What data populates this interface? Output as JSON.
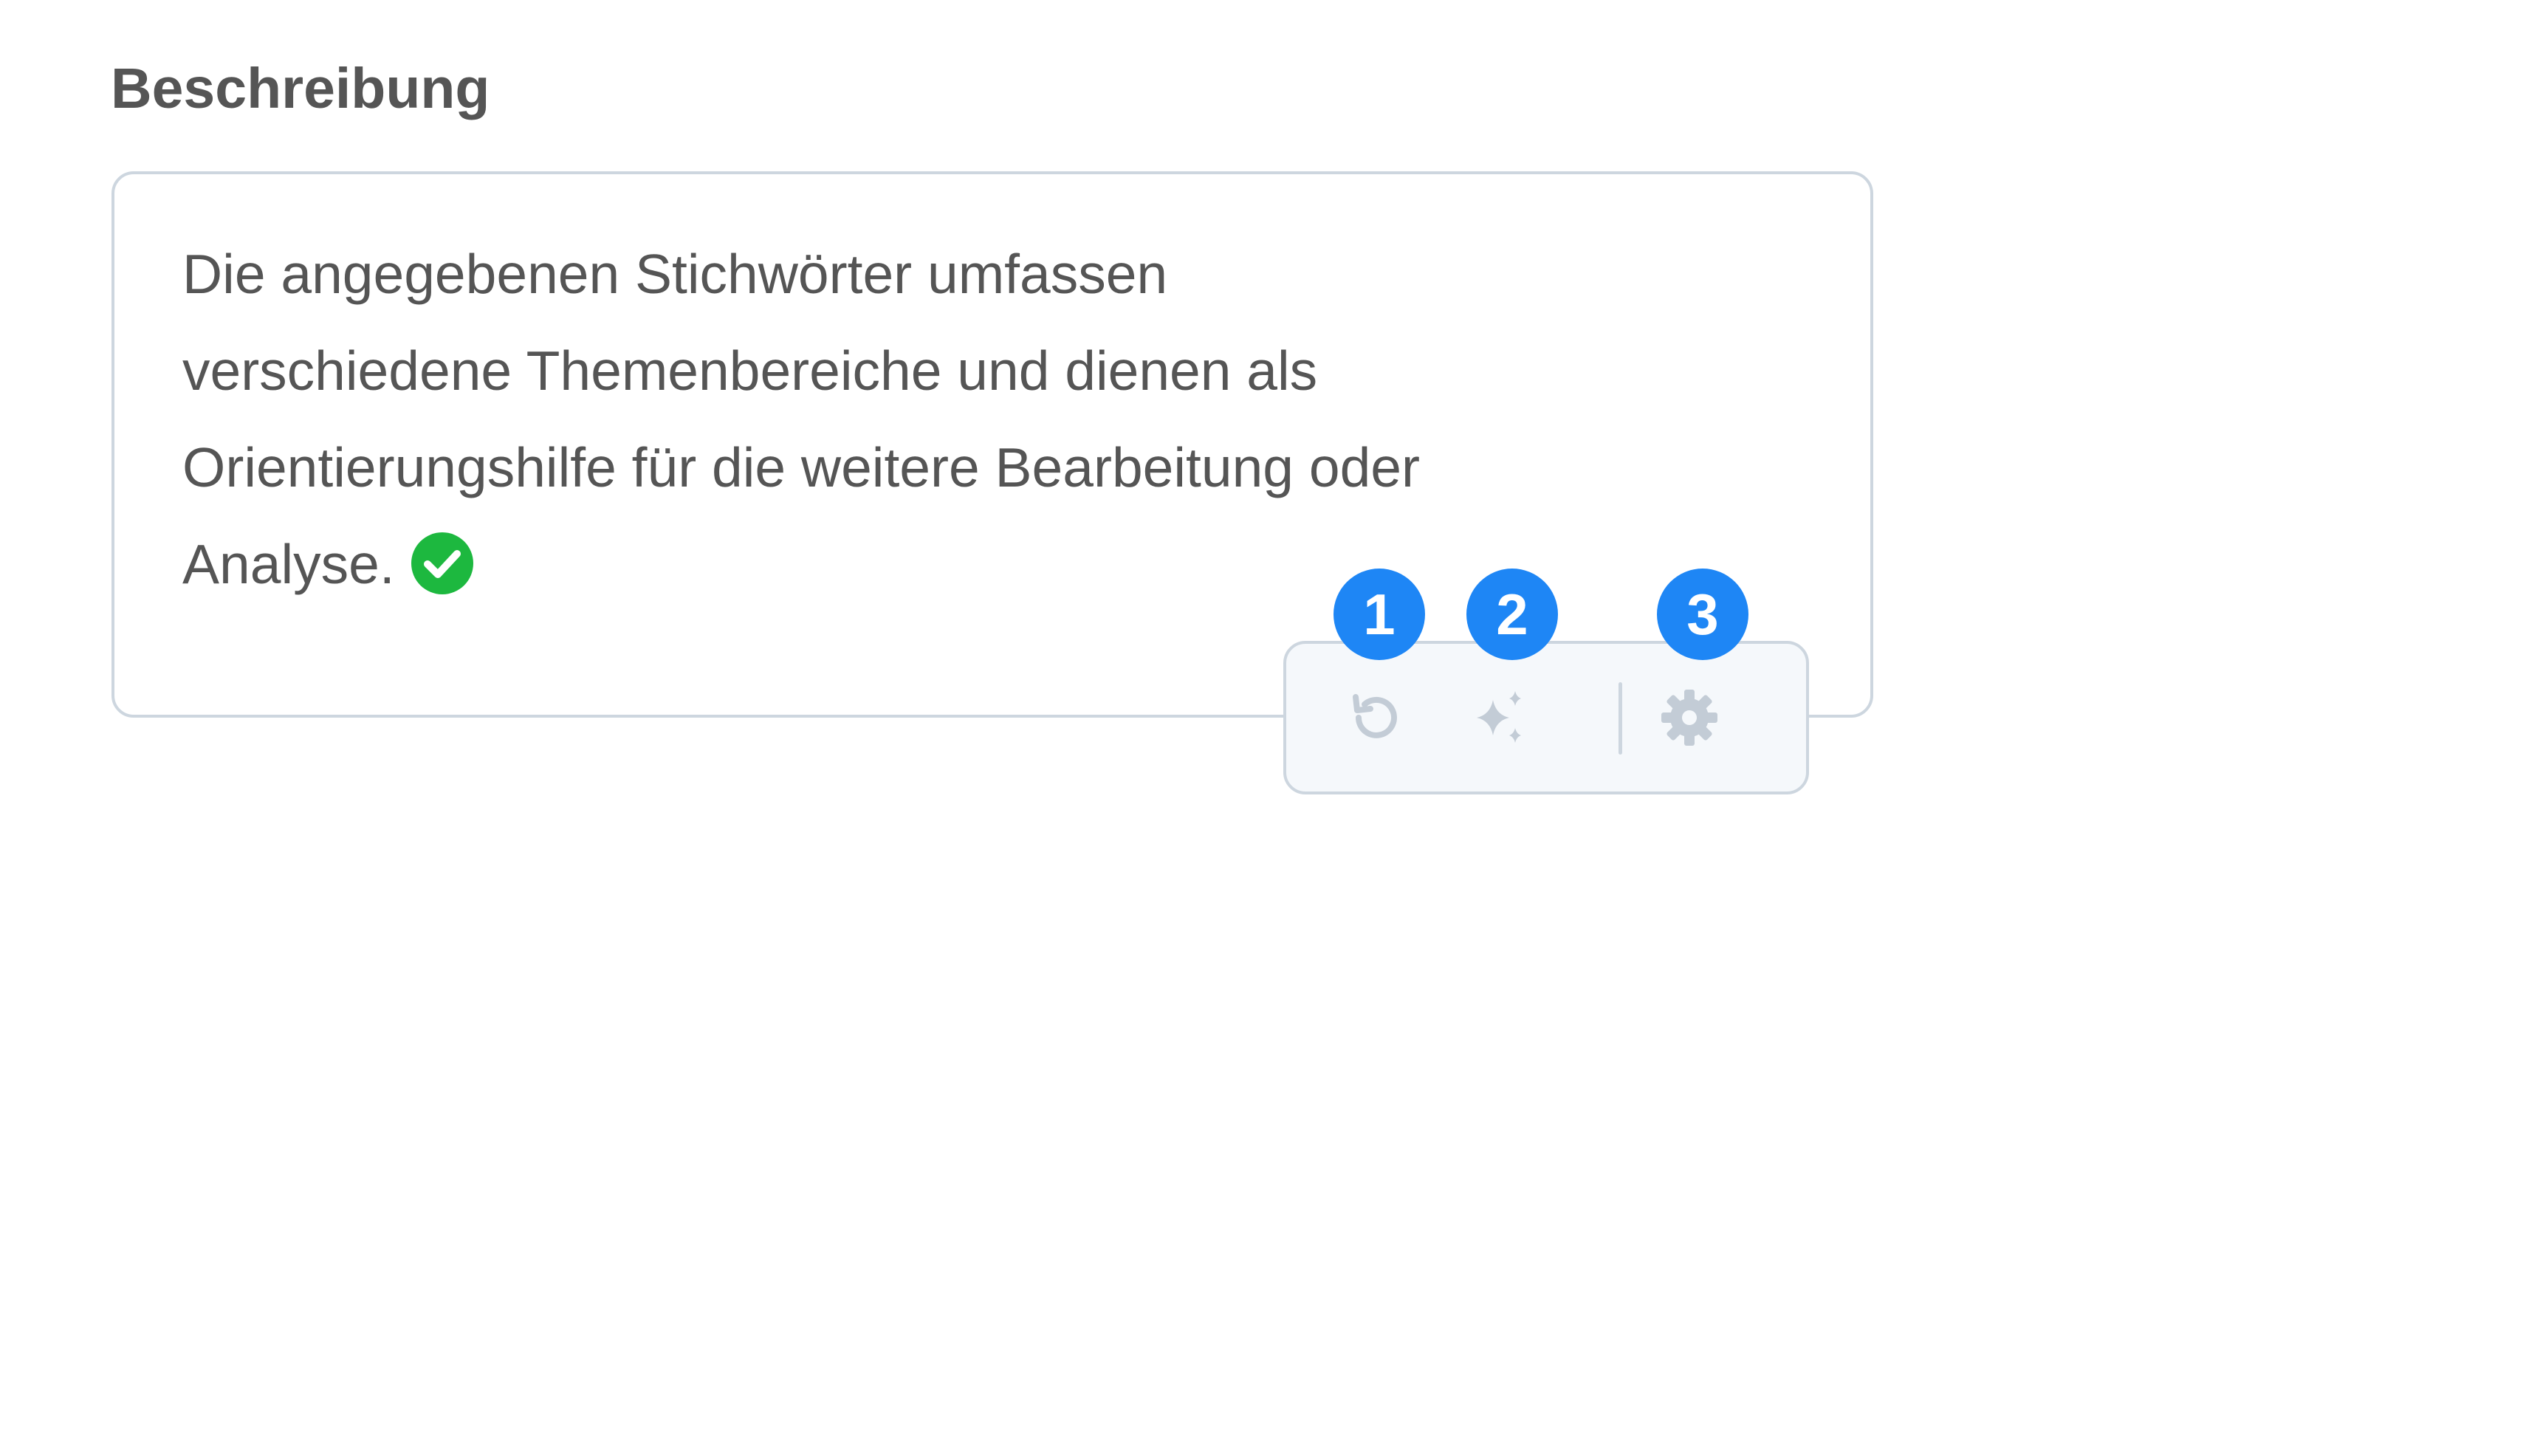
{
  "field": {
    "label": "Beschreibung",
    "lines": [
      "Die angegebenen Stichwörter umfassen",
      "verschiedene Themenbereiche und dienen als",
      "Orientierungshilfe für die weitere Bearbeitung oder",
      "Analyse."
    ],
    "status_icon": "check-circle-icon",
    "status_color": "#1db83f"
  },
  "toolbar": {
    "buttons": [
      {
        "icon": "undo-icon"
      },
      {
        "icon": "sparkles-icon"
      },
      {
        "icon": "gear-icon"
      }
    ],
    "icon_color": "#c3ccd6"
  },
  "badges": [
    "1",
    "2",
    "3"
  ],
  "colors": {
    "badge": "#1e86f5",
    "border": "#cdd6df",
    "text": "#555555"
  }
}
